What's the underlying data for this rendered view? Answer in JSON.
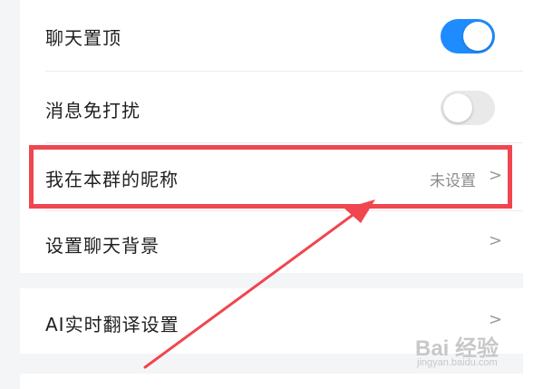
{
  "settings": {
    "rows": [
      {
        "label": "聊天置顶",
        "control": "toggle",
        "state": "on"
      },
      {
        "label": "消息免打扰",
        "control": "toggle",
        "state": "off"
      },
      {
        "label": "我在本群的昵称",
        "control": "chevron",
        "value": "未设置"
      },
      {
        "label": "设置聊天背景",
        "control": "chevron"
      },
      {
        "label": "AI实时翻译设置",
        "control": "chevron"
      }
    ],
    "chevron_glyph": ">"
  },
  "annotation": {
    "highlight_color": "#f0464f",
    "arrow_color": "#f0464f"
  },
  "watermark": {
    "logo": "Bai 经验",
    "sub": "jingyan.baidu.com"
  },
  "colors": {
    "toggle_on": "#1e8cff",
    "toggle_off": "#e9e9ea",
    "section_gap": "#f4f5f7"
  }
}
